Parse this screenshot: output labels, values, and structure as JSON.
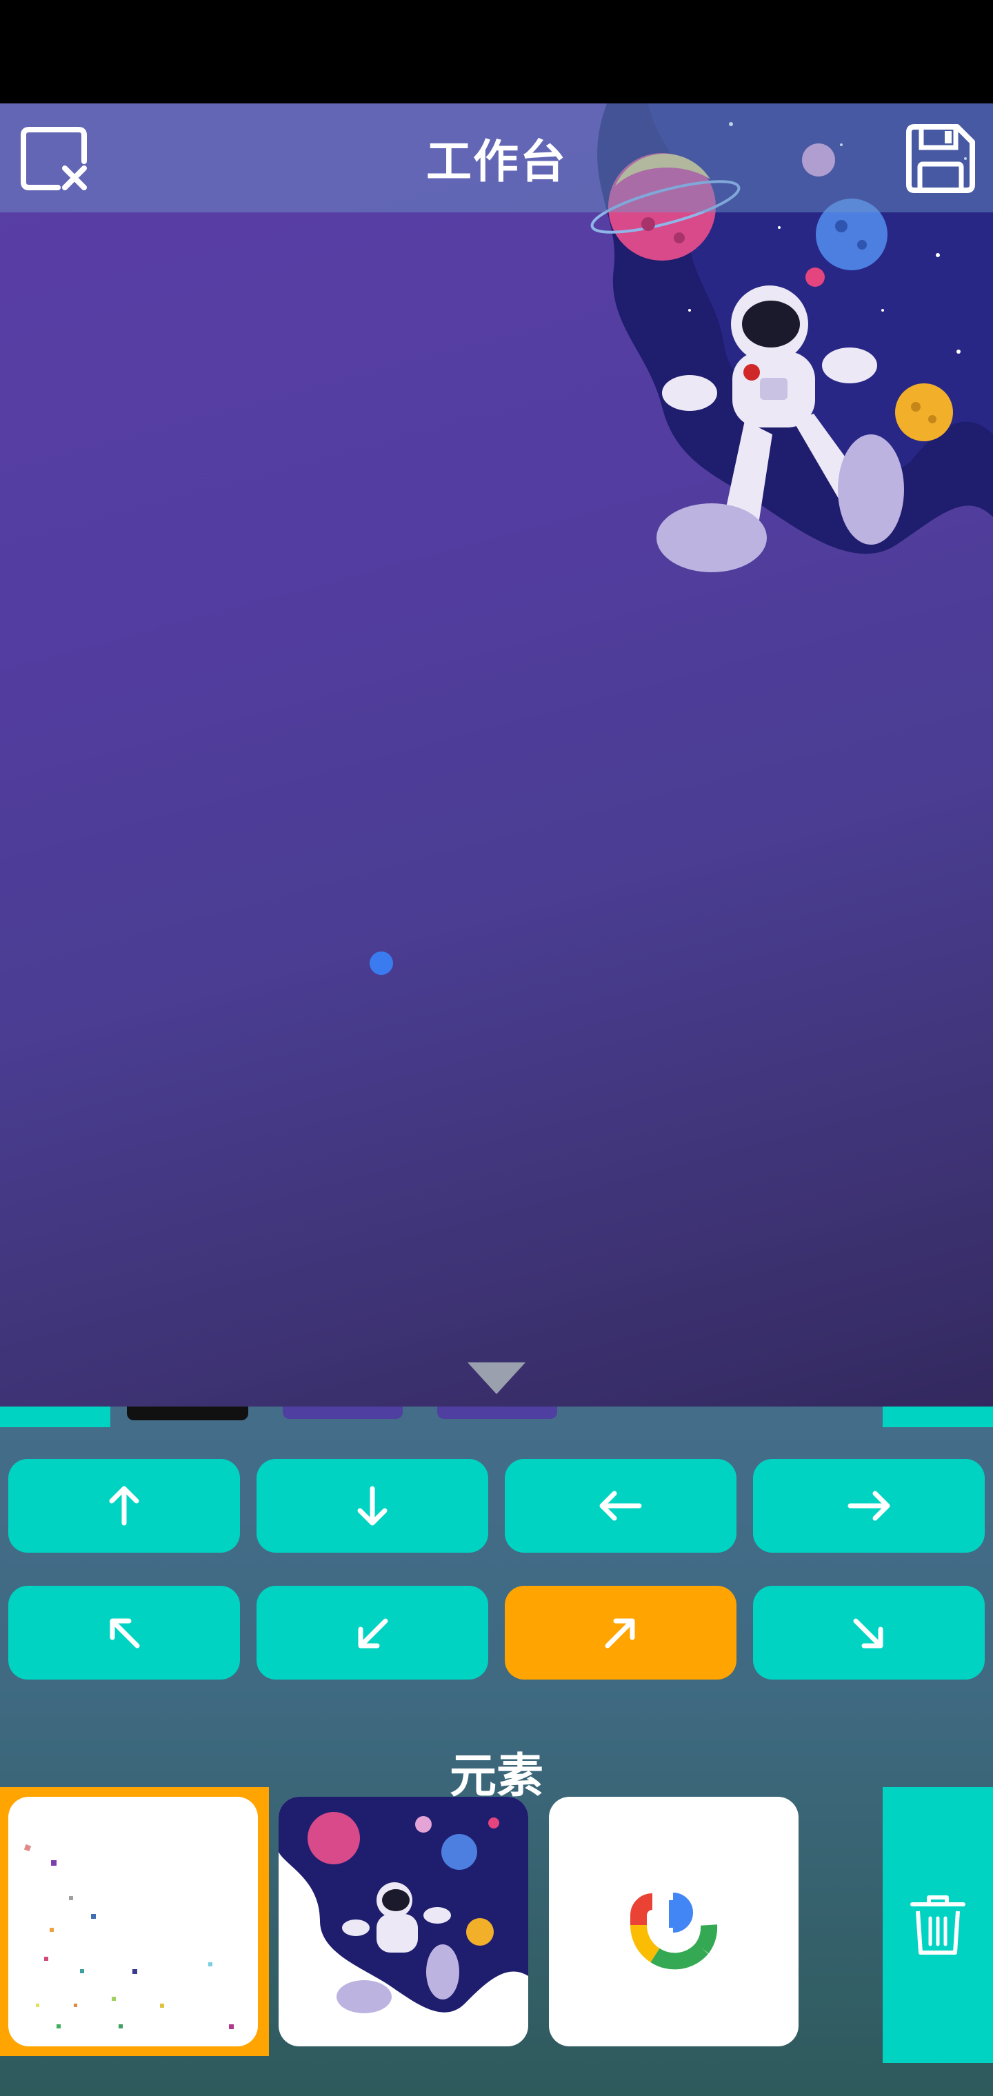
{
  "header": {
    "title": "工作台",
    "close_icon": "close-canvas-icon",
    "save_icon": "save-floppy-icon"
  },
  "canvas": {
    "background_colors": [
      "#5a3fa6",
      "#33295f"
    ],
    "dot_color": "#3a7cf0"
  },
  "direction_buttons": [
    {
      "name": "up",
      "icon": "arrow-up-icon",
      "active": false
    },
    {
      "name": "down",
      "icon": "arrow-down-icon",
      "active": false
    },
    {
      "name": "left",
      "icon": "arrow-left-icon",
      "active": false
    },
    {
      "name": "right",
      "icon": "arrow-right-icon",
      "active": false
    },
    {
      "name": "up-left",
      "icon": "arrow-up-left-icon",
      "active": false
    },
    {
      "name": "down-left",
      "icon": "arrow-down-left-icon",
      "active": false
    },
    {
      "name": "up-right",
      "icon": "arrow-up-right-icon",
      "active": true
    },
    {
      "name": "down-right",
      "icon": "arrow-down-right-icon",
      "active": false
    }
  ],
  "elements": {
    "title": "元素",
    "items": [
      {
        "name": "confetti",
        "selected": true
      },
      {
        "name": "astronaut-space",
        "selected": false
      },
      {
        "name": "google-logo",
        "selected": false
      }
    ],
    "delete_icon": "trash-icon"
  },
  "colors": {
    "accent": "#00d3c2",
    "active": "#ffa400",
    "header_overlay": "rgba(110,150,200,0.45)"
  }
}
